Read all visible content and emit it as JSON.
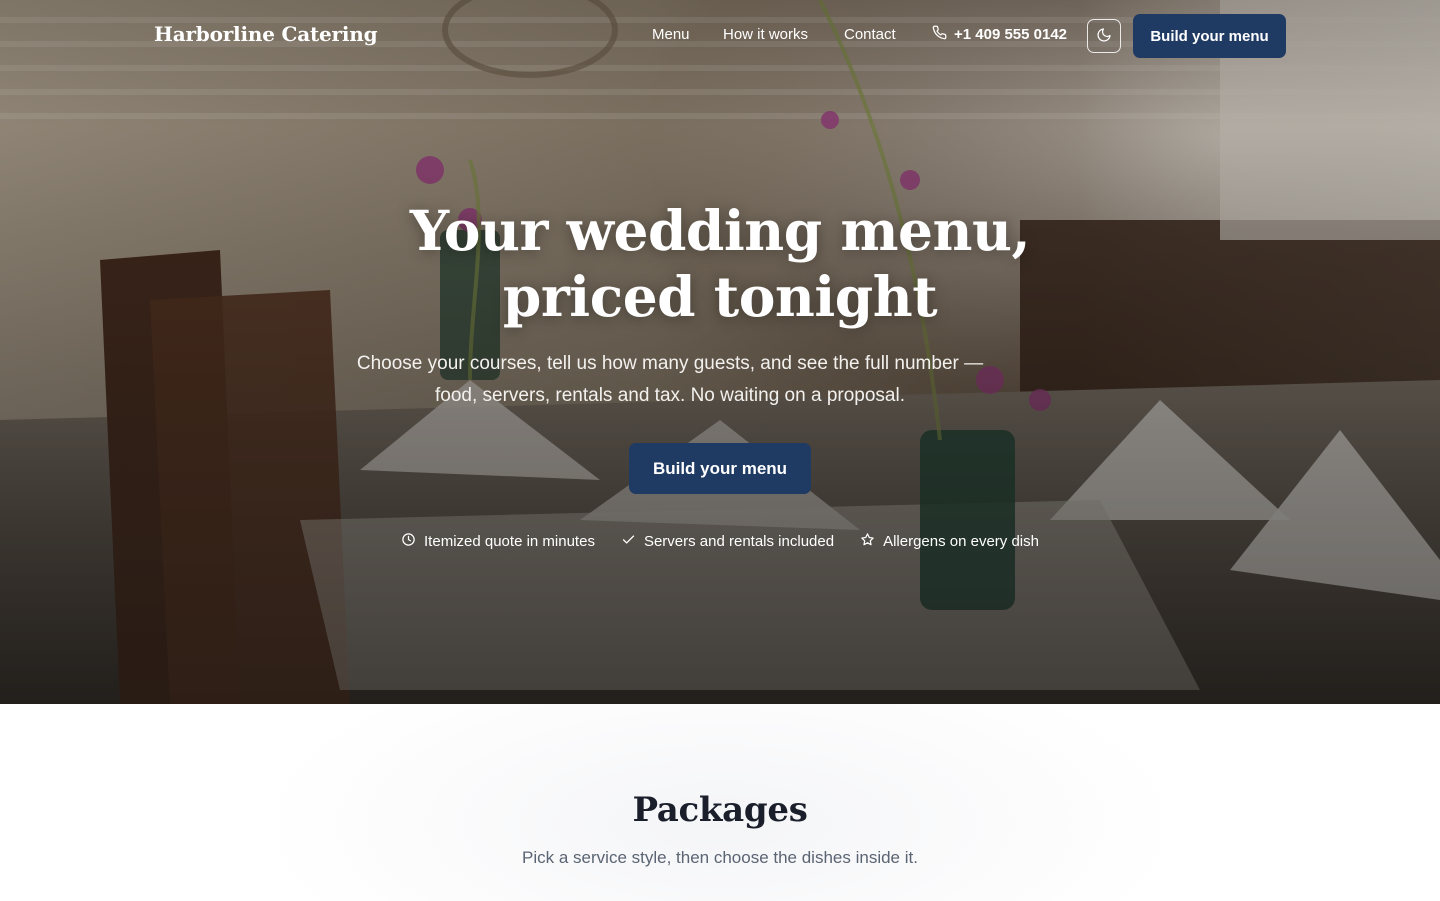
{
  "brand": {
    "name": "Harborline Catering"
  },
  "nav": {
    "links": [
      "Menu",
      "How it works",
      "Contact"
    ],
    "phone": "+1 409 555 0142",
    "theme_icon": "moon-icon",
    "cta_label": "Build your menu"
  },
  "hero": {
    "title_line1": "Your wedding menu,",
    "title_line2": "priced tonight",
    "subtitle": "Choose your courses, tell us how many guests, and see the full number — food, servers, rentals and tax. No waiting on a proposal.",
    "cta_label": "Build your menu",
    "features": [
      {
        "icon": "clock-icon",
        "label": "Itemized quote in minutes"
      },
      {
        "icon": "check-icon",
        "label": "Servers and rentals included"
      },
      {
        "icon": "star-icon",
        "label": "Allergens on every dish"
      }
    ]
  },
  "packages": {
    "title": "Packages",
    "subtitle": "Pick a service style, then choose the dishes inside it."
  },
  "colors": {
    "primary": "#1f3a63",
    "text_dark": "#1a1f2b",
    "text_muted": "#5b6473"
  }
}
